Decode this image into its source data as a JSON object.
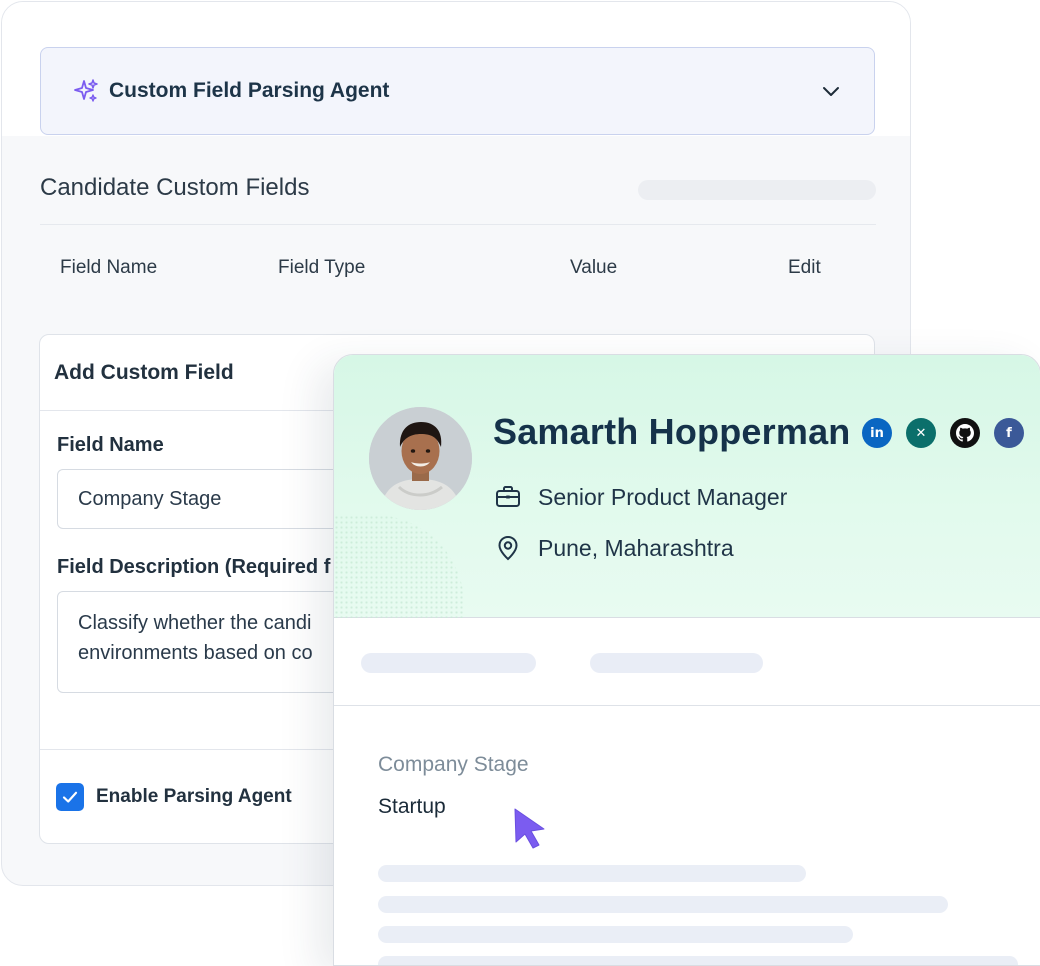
{
  "agent_bar": {
    "title": "Custom Field Parsing Agent",
    "icon": "sparkle-icon",
    "toggle_icon": "chevron-down-icon"
  },
  "section": {
    "title": "Candidate Custom Fields"
  },
  "table": {
    "columns": [
      "Field Name",
      "Field Type",
      "Value",
      "Edit"
    ]
  },
  "add_panel": {
    "title": "Add Custom Field",
    "field_name_label": "Field Name",
    "field_name_value": "Company Stage",
    "description_label": "Field Description (Required f",
    "description_lines": [
      "Classify whether the candi",
      "environments based on co"
    ],
    "checkbox_label": "Enable Parsing Agent",
    "checkbox_checked": true
  },
  "profile": {
    "name": "Samarth Hopperman",
    "title": "Senior Product Manager",
    "location": "Pune, Maharashtra",
    "socials": [
      {
        "name": "linkedin-icon",
        "glyph": "in",
        "color": "#0a66c2"
      },
      {
        "name": "xing-icon",
        "glyph": "✕",
        "color": "#0b6f6b"
      },
      {
        "name": "github-icon",
        "glyph": "",
        "color": "#111111"
      },
      {
        "name": "facebook-icon",
        "glyph": "f",
        "color": "#3b5998"
      }
    ],
    "custom_field_label": "Company Stage",
    "custom_field_value": "Startup"
  },
  "colors": {
    "accent": "#1a73e8",
    "hero_bg": "#d9f8e8",
    "cursor": "#7b5cf0",
    "sparkle": "#7b5cf0"
  }
}
